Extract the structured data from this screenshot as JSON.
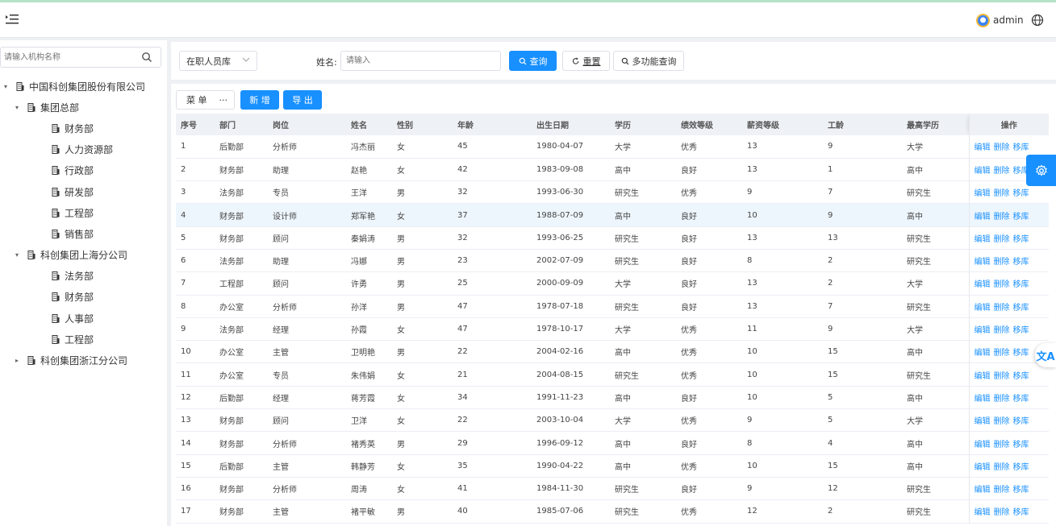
{
  "header": {
    "user": "admin"
  },
  "sidebar": {
    "search_placeholder": "请输入机构名称",
    "tree": [
      {
        "label": "中国科创集团股份有限公司",
        "level": 0,
        "arrow": "▾"
      },
      {
        "label": "集团总部",
        "level": 1,
        "arrow": "▾"
      },
      {
        "label": "财务部",
        "level": 2,
        "arrow": ""
      },
      {
        "label": "人力资源部",
        "level": 2,
        "arrow": ""
      },
      {
        "label": "行政部",
        "level": 2,
        "arrow": ""
      },
      {
        "label": "研发部",
        "level": 2,
        "arrow": ""
      },
      {
        "label": "工程部",
        "level": 2,
        "arrow": ""
      },
      {
        "label": "销售部",
        "level": 2,
        "arrow": ""
      },
      {
        "label": "科创集团上海分公司",
        "level": 1,
        "arrow": "▾"
      },
      {
        "label": "法务部",
        "level": 2,
        "arrow": ""
      },
      {
        "label": "财务部",
        "level": 2,
        "arrow": ""
      },
      {
        "label": "人事部",
        "level": 2,
        "arrow": ""
      },
      {
        "label": "工程部",
        "level": 2,
        "arrow": ""
      },
      {
        "label": "科创集团浙江分公司",
        "level": 1,
        "arrow": "▸"
      }
    ]
  },
  "filter": {
    "select_value": "在职人员库",
    "name_label": "姓名:",
    "name_placeholder": "请输入",
    "query": "查询",
    "reset": "重置",
    "advanced": "多功能查询"
  },
  "toolbar": {
    "menu": "菜 单",
    "more": "···",
    "add": "新 增",
    "export": "导 出"
  },
  "table": {
    "columns": [
      "序号",
      "部门",
      "岗位",
      "姓名",
      "性别",
      "年龄",
      "出生日期",
      "学历",
      "绩效等级",
      "薪资等级",
      "工龄",
      "最高学历",
      "操作"
    ],
    "actions": [
      "编辑",
      "删除",
      "移库"
    ],
    "rows": [
      [
        "1",
        "后勤部",
        "分析师",
        "冯杰丽",
        "女",
        "45",
        "1980-04-07",
        "大学",
        "优秀",
        "13",
        "9",
        "大学"
      ],
      [
        "2",
        "财务部",
        "助理",
        "赵艳",
        "女",
        "42",
        "1983-09-08",
        "高中",
        "良好",
        "13",
        "1",
        "高中"
      ],
      [
        "3",
        "法务部",
        "专员",
        "王洋",
        "男",
        "32",
        "1993-06-30",
        "研究生",
        "优秀",
        "9",
        "7",
        "研究生"
      ],
      [
        "4",
        "财务部",
        "设计师",
        "郑军艳",
        "女",
        "37",
        "1988-07-09",
        "高中",
        "良好",
        "10",
        "9",
        "高中"
      ],
      [
        "5",
        "财务部",
        "顾问",
        "秦娟涛",
        "男",
        "32",
        "1993-06-25",
        "研究生",
        "良好",
        "13",
        "13",
        "研究生"
      ],
      [
        "6",
        "法务部",
        "助理",
        "冯娜",
        "男",
        "23",
        "2002-07-09",
        "研究生",
        "良好",
        "8",
        "2",
        "研究生"
      ],
      [
        "7",
        "工程部",
        "顾问",
        "许勇",
        "男",
        "25",
        "2000-09-09",
        "大学",
        "良好",
        "13",
        "2",
        "大学"
      ],
      [
        "8",
        "办公室",
        "分析师",
        "孙洋",
        "男",
        "47",
        "1978-07-18",
        "研究生",
        "良好",
        "13",
        "7",
        "研究生"
      ],
      [
        "9",
        "法务部",
        "经理",
        "孙霞",
        "女",
        "47",
        "1978-10-17",
        "大学",
        "优秀",
        "11",
        "9",
        "大学"
      ],
      [
        "10",
        "办公室",
        "主管",
        "卫明艳",
        "男",
        "22",
        "2004-02-16",
        "高中",
        "优秀",
        "10",
        "15",
        "高中"
      ],
      [
        "11",
        "办公室",
        "专员",
        "朱伟娟",
        "女",
        "21",
        "2004-08-15",
        "研究生",
        "优秀",
        "10",
        "15",
        "研究生"
      ],
      [
        "12",
        "后勤部",
        "经理",
        "蒋芳霞",
        "女",
        "34",
        "1991-11-23",
        "高中",
        "良好",
        "10",
        "5",
        "高中"
      ],
      [
        "13",
        "财务部",
        "顾问",
        "卫洋",
        "女",
        "22",
        "2003-10-04",
        "大学",
        "优秀",
        "9",
        "5",
        "大学"
      ],
      [
        "14",
        "财务部",
        "分析师",
        "褚秀英",
        "男",
        "29",
        "1996-09-12",
        "高中",
        "良好",
        "8",
        "4",
        "高中"
      ],
      [
        "15",
        "后勤部",
        "主管",
        "韩静芳",
        "女",
        "35",
        "1990-04-22",
        "高中",
        "优秀",
        "10",
        "15",
        "高中"
      ],
      [
        "16",
        "财务部",
        "分析师",
        "周涛",
        "女",
        "41",
        "1984-11-30",
        "研究生",
        "良好",
        "9",
        "12",
        "研究生"
      ],
      [
        "17",
        "财务部",
        "主管",
        "褚平敏",
        "男",
        "40",
        "1985-07-06",
        "研究生",
        "优秀",
        "12",
        "2",
        "研究生"
      ]
    ],
    "highlighted_row": 3
  },
  "float": {
    "translate": "文A"
  },
  "colors": {
    "primary": "#1890ff",
    "header_bg": "#eef1f6",
    "highlight": "#eef6fd"
  }
}
